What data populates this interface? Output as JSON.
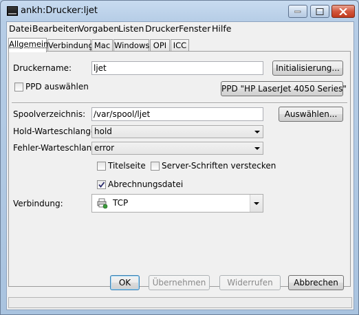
{
  "window": {
    "title": "ankh:Drucker:ljet"
  },
  "menu": [
    "Datei",
    "Bearbeiten",
    "Vorgaben",
    "Listen",
    "Drucker",
    "Fenster",
    "Hilfe"
  ],
  "tabs": [
    "Allgemein",
    "Verbindung",
    "Mac",
    "Windows",
    "OPI",
    "ICC"
  ],
  "active_tab": "Allgemein",
  "form": {
    "druckername_label": "Druckername:",
    "druckername_value": "ljet",
    "init_button": "Initialisierung...",
    "ppd_checkbox_label": "PPD auswählen",
    "ppd_checked": false,
    "ppd_button": "PPD \"HP LaserJet 4050 Series\"",
    "spool_label": "Spoolverzeichnis:",
    "spool_value": "/var/spool/ljet",
    "spool_button": "Auswählen...",
    "hold_label": "Hold-Warteschlange:",
    "hold_value": "hold",
    "error_label": "Fehler-Warteschlange:",
    "error_value": "error",
    "titelseite_label": "Titelseite",
    "titelseite_checked": false,
    "server_fonts_label": "Server-Schriften verstecken",
    "server_fonts_checked": false,
    "abrechnung_label": "Abrechnungsdatei",
    "abrechnung_checked": true,
    "verbindung_label": "Verbindung:",
    "verbindung_value": "TCP",
    "verbindung_icon": "printer-network-icon"
  },
  "buttons": {
    "ok": "OK",
    "apply": "Übernehmen",
    "revert": "Widerrufen",
    "cancel": "Abbrechen"
  }
}
